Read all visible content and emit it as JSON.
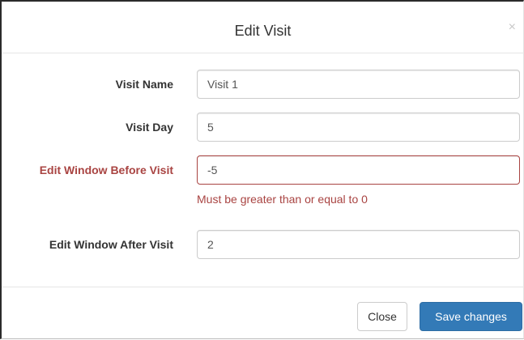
{
  "dialog": {
    "title": "Edit Visit",
    "close_glyph": "×"
  },
  "form": {
    "visit_name": {
      "label": "Visit Name",
      "value": "Visit 1"
    },
    "visit_day": {
      "label": "Visit Day",
      "value": "5"
    },
    "window_before": {
      "label": "Edit Window Before Visit",
      "value": "-5",
      "error": "Must be greater than or equal to 0"
    },
    "window_after": {
      "label": "Edit Window After Visit",
      "value": "2"
    }
  },
  "footer": {
    "close_label": "Close",
    "save_label": "Save changes"
  },
  "colors": {
    "primary": "#337ab7",
    "error": "#a94442",
    "text": "#333333"
  },
  "icons": {
    "close": "close-icon"
  }
}
